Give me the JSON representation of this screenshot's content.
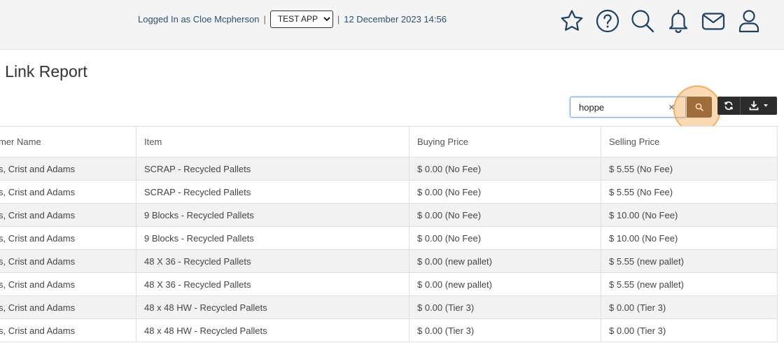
{
  "header": {
    "logged_in_text": "Logged In as Cloe Mcpherson",
    "separator": "|",
    "app_select": {
      "selected": "TEST APP",
      "options": [
        "TEST APP"
      ]
    },
    "datetime": "12 December 2023 14:56",
    "icons": [
      "star-icon",
      "help-icon",
      "search-icon",
      "bell-icon",
      "mail-icon",
      "user-icon"
    ]
  },
  "page": {
    "title": "e Link Report"
  },
  "toolbar": {
    "search_value": "hoppe",
    "clear_label": "×"
  },
  "table": {
    "columns": [
      "mer Name",
      "Item",
      "Buying Price",
      "Selling Price"
    ],
    "rows": [
      [
        "s, Crist and Adams",
        "SCRAP - Recycled Pallets",
        "$ 0.00 (No Fee)",
        "$ 5.55 (No Fee)"
      ],
      [
        "s, Crist and Adams",
        "SCRAP - Recycled Pallets",
        "$ 0.00 (No Fee)",
        "$ 5.55 (No Fee)"
      ],
      [
        "s, Crist and Adams",
        "9 Blocks - Recycled Pallets",
        "$ 0.00 (No Fee)",
        "$ 10.00 (No Fee)"
      ],
      [
        "s, Crist and Adams",
        "9 Blocks - Recycled Pallets",
        "$ 0.00 (No Fee)",
        "$ 10.00 (No Fee)"
      ],
      [
        "s, Crist and Adams",
        "48 X 36 - Recycled Pallets",
        "$ 0.00 (new pallet)",
        "$ 5.55 (new pallet)"
      ],
      [
        "s, Crist and Adams",
        "48 X 36 - Recycled Pallets",
        "$ 0.00 (new pallet)",
        "$ 5.55 (new pallet)"
      ],
      [
        "s, Crist and Adams",
        "48 x 48 HW - Recycled Pallets",
        "$ 0.00 (Tier 3)",
        "$ 0.00 (Tier 3)"
      ],
      [
        "s, Crist and Adams",
        "48 x 48 HW - Recycled Pallets",
        "$ 0.00 (Tier 3)",
        "$ 0.00 (Tier 3)"
      ]
    ]
  },
  "colors": {
    "accent_search_button": "#5a3a22",
    "highlight": "#f5aa5a",
    "header_text": "#2d4f6f",
    "icon_stroke": "#1f3f63"
  }
}
